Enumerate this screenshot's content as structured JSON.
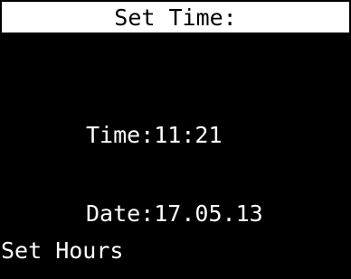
{
  "screen": {
    "title": "Set Time:",
    "time_line": "Time:11:21",
    "date_line": "Date:17.05.13",
    "softkey_label": "Set Hours"
  },
  "colors": {
    "background": "#000000",
    "title_background": "#ffffff",
    "title_text": "#000000",
    "text": "#ffffff"
  }
}
